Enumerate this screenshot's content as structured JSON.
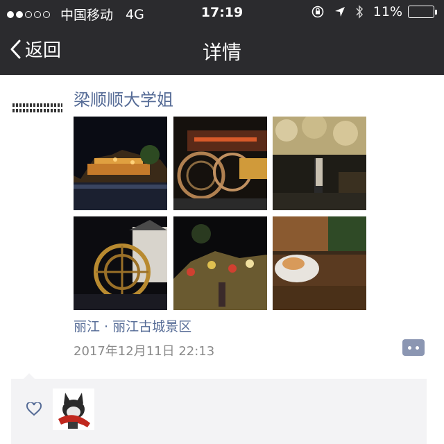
{
  "status_bar": {
    "carrier": "中国移动",
    "network": "4G",
    "time": "17:19",
    "battery_percent": "11%",
    "battery_level": 0.11,
    "battery_color": "#f5c542",
    "signal_dots_filled": 2,
    "signal_dots_total": 5,
    "icons": [
      "rotation-lock-icon",
      "location-arrow-icon",
      "bluetooth-icon"
    ]
  },
  "nav": {
    "back_label": "返回",
    "title": "详情"
  },
  "post": {
    "username": "梁顺顺大学姐",
    "avatar_caption_lines": [
      "吾是第一大二时堂信",
      "这个世界支出完支出"
    ],
    "photos": [
      {
        "name": "photo-night-town"
      },
      {
        "name": "photo-water-wheels"
      },
      {
        "name": "photo-flower-street"
      },
      {
        "name": "photo-big-water-wheel"
      },
      {
        "name": "photo-lit-tree"
      },
      {
        "name": "photo-sleeping-cat"
      }
    ],
    "location": "丽江 · 丽江古城景区",
    "timestamp": "2017年12月11日 22:13"
  },
  "likes": {
    "icon": "heart-icon"
  },
  "colors": {
    "nav_bg": "#2b2b2e",
    "link_blue": "#556b96",
    "meta_gray": "#8a8a8a",
    "comment_btn": "#8b96b2",
    "likes_bg": "#f3f3f5"
  }
}
